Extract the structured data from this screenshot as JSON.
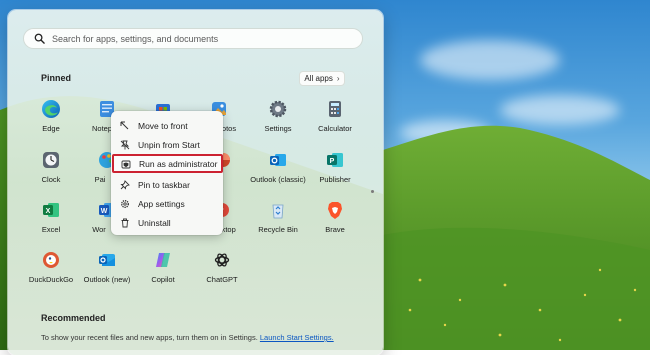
{
  "search": {
    "placeholder": "Search for apps, settings, and documents"
  },
  "pinned": {
    "title": "Pinned",
    "all_apps_label": "All apps",
    "apps": [
      {
        "label": "Edge",
        "icon": "edge-icon"
      },
      {
        "label": "Notep",
        "icon": "notepad-icon"
      },
      {
        "label": "",
        "icon": "store-icon"
      },
      {
        "label": "otos",
        "icon": "photos-icon"
      },
      {
        "label": "Settings",
        "icon": "settings-icon"
      },
      {
        "label": "Calculator",
        "icon": "calculator-icon"
      },
      {
        "label": "Clock",
        "icon": "clock-icon"
      },
      {
        "label": "Pai",
        "icon": "paint-icon"
      },
      {
        "label": "",
        "icon": "powerpoint-icon"
      },
      {
        "label": "Outlook (classic)",
        "icon": "outlook-icon"
      },
      {
        "label": "Publisher",
        "icon": "publisher-icon"
      },
      {
        "label": "Excel",
        "icon": "excel-icon"
      },
      {
        "label": "Wor",
        "icon": "word-icon"
      },
      {
        "label": "Desktop",
        "icon": "desktop-icon"
      },
      {
        "label": "Recycle Bin",
        "icon": "recycle-bin-icon"
      },
      {
        "label": "Brave",
        "icon": "brave-icon"
      },
      {
        "label": "DuckDuckGo",
        "icon": "duckduckgo-icon"
      },
      {
        "label": "Outlook (new)",
        "icon": "outlook-new-icon"
      },
      {
        "label": "Copilot",
        "icon": "copilot-icon"
      },
      {
        "label": "ChatGPT",
        "icon": "chatgpt-icon"
      }
    ]
  },
  "context_menu": {
    "items": [
      {
        "label": "Move to front",
        "icon": "move-icon",
        "highlighted": false
      },
      {
        "label": "Unpin from Start",
        "icon": "unpin-icon",
        "highlighted": false
      },
      {
        "label": "Run as administrator",
        "icon": "shield-icon",
        "highlighted": true
      },
      {
        "label": "Pin to taskbar",
        "icon": "pin-icon",
        "highlighted": false
      },
      {
        "label": "App settings",
        "icon": "gear-icon",
        "highlighted": false
      },
      {
        "label": "Uninstall",
        "icon": "trash-icon",
        "highlighted": false
      }
    ],
    "highlight_color": "#cc2231"
  },
  "recommended": {
    "title": "Recommended",
    "text": "To show your recent files and new apps, turn them on in Settings.",
    "link": "Launch Start Settings."
  }
}
